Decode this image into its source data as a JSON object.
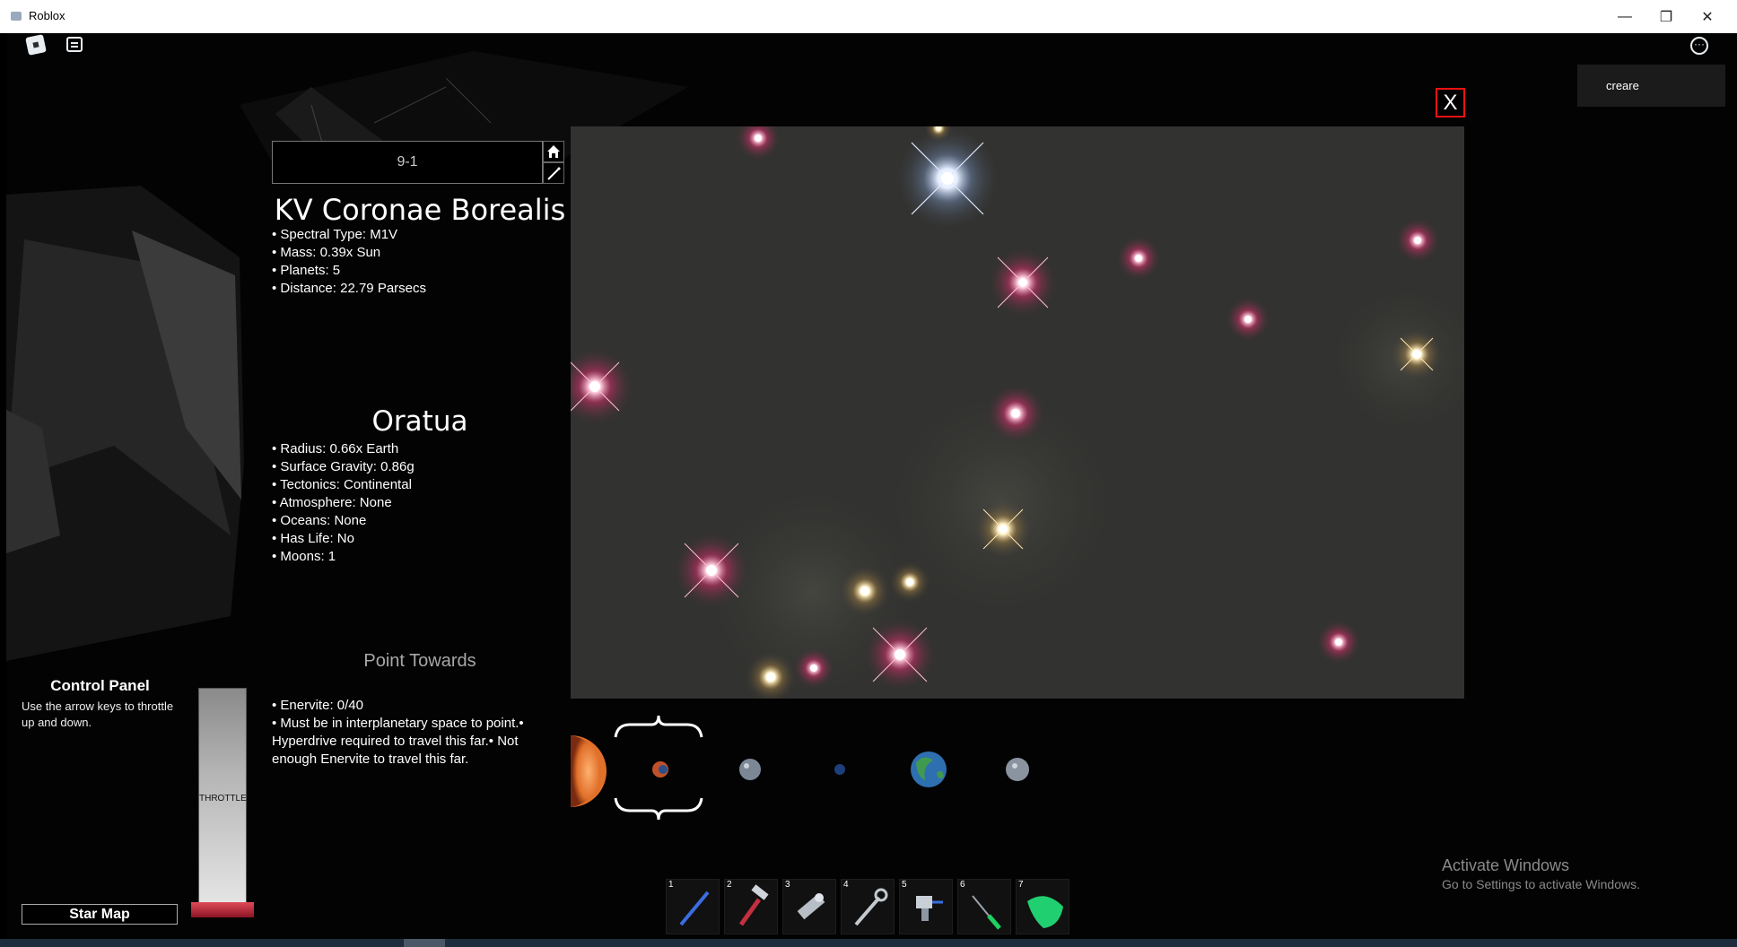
{
  "window": {
    "title": "Roblox"
  },
  "roblox_topbar": {
    "creare_label": "creare"
  },
  "close_label": "X",
  "search": {
    "value": "9-1"
  },
  "star": {
    "name": "KV Coronae Borealis",
    "facts": [
      "• Spectral Type: M1V",
      "• Mass: 0.39x Sun",
      "• Planets: 5",
      "• Distance: 22.79 Parsecs"
    ]
  },
  "planet": {
    "name": "Oratua",
    "facts": [
      "• Radius: 0.66x Earth",
      "• Surface Gravity: 0.86g",
      "• Tectonics: Continental",
      "• Atmosphere: None",
      "• Oceans: None",
      "• Has Life: No",
      "• Moons: 1"
    ]
  },
  "point_towards": {
    "label": "Point Towards",
    "notes": "• Enervite: 0/40\n• Must be in interplanetary space to point.• Hyperdrive required to travel this far.• Not enough Enervite to travel this far."
  },
  "control_panel": {
    "title": "Control Panel",
    "description": "Use the arrow keys to throttle up and down.",
    "throttle_label": "THROTTLE",
    "star_map_button": "Star Map"
  },
  "hotbar": {
    "slots": [
      {
        "number": "1",
        "icon": "blue-rod-icon"
      },
      {
        "number": "2",
        "icon": "hammer-icon"
      },
      {
        "number": "3",
        "icon": "scanner-icon"
      },
      {
        "number": "4",
        "icon": "wrench-icon"
      },
      {
        "number": "5",
        "icon": "drill-icon"
      },
      {
        "number": "6",
        "icon": "green-screwdriver-icon"
      },
      {
        "number": "7",
        "icon": "green-dish-icon"
      }
    ]
  },
  "planets_strip": [
    "star-sun-icon",
    "selected-planet-icon",
    "grey-planet-icon",
    "tiny-blue-planet-icon",
    "earth-like-planet-icon",
    "moon-planet-icon"
  ],
  "watermark": {
    "line1": "Activate Windows",
    "line2": "Go to Settings to activate Windows."
  },
  "colors": {
    "close_border": "#e11111",
    "starmap_bg": "#323230",
    "throttle_base": "#c42a3a"
  }
}
